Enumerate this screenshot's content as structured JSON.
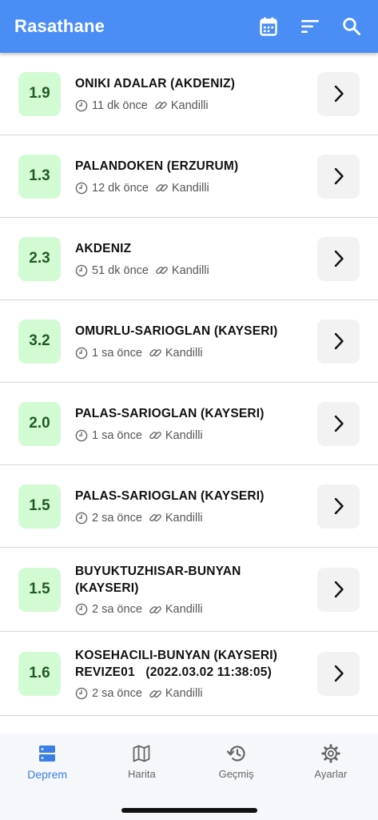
{
  "appbar": {
    "title": "Rasathane",
    "actions": [
      {
        "name": "calendar-icon"
      },
      {
        "name": "sort-icon"
      },
      {
        "name": "search-icon"
      }
    ]
  },
  "colors": {
    "primary": "#4a8ef5",
    "magnitude_bg": "#d3fbd3",
    "magnitude_text": "#1f5a24",
    "active_tab": "#3a7ee8"
  },
  "quakes": [
    {
      "mag": "1.9",
      "loc_line1": "ONIKI ADALAR (AKDENIZ)",
      "loc_line2": "",
      "time": "11 dk önce",
      "source": "Kandilli"
    },
    {
      "mag": "1.3",
      "loc_line1": "PALANDOKEN (ERZURUM)",
      "loc_line2": "",
      "time": "12 dk önce",
      "source": "Kandilli"
    },
    {
      "mag": "2.3",
      "loc_line1": "AKDENIZ",
      "loc_line2": "",
      "time": "51 dk önce",
      "source": "Kandilli"
    },
    {
      "mag": "3.2",
      "loc_line1": "OMURLU-SARIOGLAN (KAYSERI)",
      "loc_line2": "",
      "time": "1 sa önce",
      "source": "Kandilli"
    },
    {
      "mag": "2.0",
      "loc_line1": "PALAS-SARIOGLAN (KAYSERI)",
      "loc_line2": "",
      "time": "1 sa önce",
      "source": "Kandilli"
    },
    {
      "mag": "1.5",
      "loc_line1": "PALAS-SARIOGLAN (KAYSERI)",
      "loc_line2": "",
      "time": "2 sa önce",
      "source": "Kandilli"
    },
    {
      "mag": "1.5",
      "loc_line1": "BUYUKTUZHISAR-BUNYAN",
      "loc_line2": "(KAYSERI)",
      "time": "2 sa önce",
      "source": "Kandilli"
    },
    {
      "mag": "1.6",
      "loc_line1": "KOSEHACILI-BUNYAN (KAYSERI)",
      "loc_line2": "REVIZE01   (2022.03.02 11:38:05)",
      "time": "2 sa önce",
      "source": "Kandilli"
    }
  ],
  "nav": {
    "tabs": [
      {
        "label": "Deprem",
        "icon": "list-icon",
        "active": true
      },
      {
        "label": "Harita",
        "icon": "map-icon",
        "active": false
      },
      {
        "label": "Geçmiş",
        "icon": "history-icon",
        "active": false
      },
      {
        "label": "Ayarlar",
        "icon": "gear-icon",
        "active": false
      }
    ]
  }
}
